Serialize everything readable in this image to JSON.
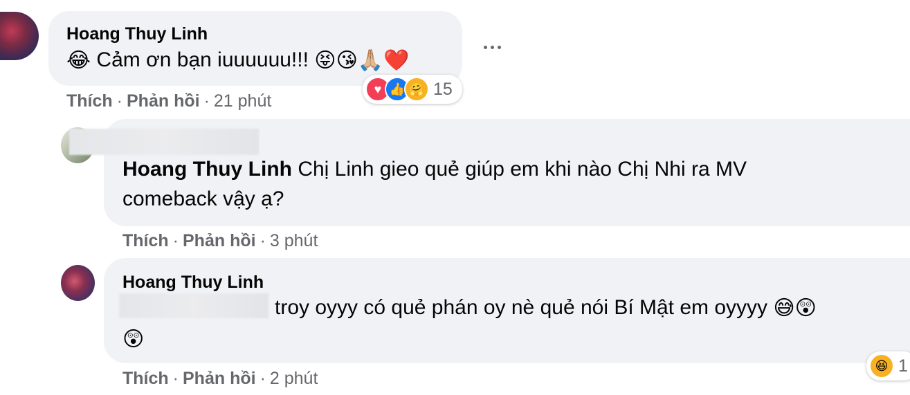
{
  "comments": [
    {
      "author": "Hoang Thuy Linh",
      "text": "Cảm ơn bạn iuuuuuu!!!",
      "emoji_lead": "😂",
      "emoji_tail": [
        "😝",
        "😘",
        "🙏🏼",
        "❤️"
      ],
      "actions": {
        "like": "Thích",
        "reply": "Phản hồi",
        "time": "21 phút"
      },
      "reactions": {
        "icons": [
          "heart-icon",
          "like-icon",
          "care-icon"
        ],
        "count": "15"
      }
    },
    {
      "mention": "Hoang Thuy Linh",
      "text_line1": "Chị Linh gieo quẻ giúp em khi nào Chị Nhi ra MV",
      "text_line2": "comeback vậy ạ?",
      "actions": {
        "like": "Thích",
        "reply": "Phản hồi",
        "time": "3 phút"
      }
    },
    {
      "author": "Hoang Thuy Linh",
      "text_line1": "troy oyyy có quẻ phán oy nè quẻ nói Bí Mật em oyyyy",
      "emoji_tail": [
        "😅",
        "😲"
      ],
      "emoji_line2": "😲",
      "actions": {
        "like": "Thích",
        "reply": "Phản hồi",
        "time": "2 phút"
      },
      "reactions": {
        "icons": [
          "haha-icon"
        ],
        "count": "1"
      }
    }
  ],
  "colors": {
    "bubble": "#f0f2f5",
    "meta_text": "#65676b",
    "heart": "#f33e58",
    "like": "#1877f2",
    "care": "#f7b125"
  }
}
